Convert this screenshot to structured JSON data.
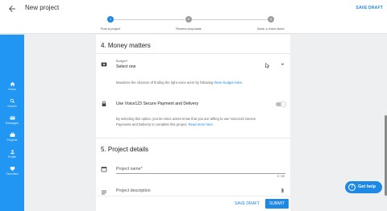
{
  "header": {
    "title": "New project",
    "save_draft": "SAVE DRAFT",
    "steps": [
      {
        "number": "1",
        "label": "Post a project",
        "active": true
      },
      {
        "number": "2",
        "label": "Review proposals",
        "active": false
      },
      {
        "number": "3",
        "label": "Book a Voice Actor",
        "active": false
      }
    ]
  },
  "sidebar": {
    "items": [
      {
        "label": "Home",
        "icon": "home-icon"
      },
      {
        "label": "Search",
        "icon": "search-icon"
      },
      {
        "label": "Messages",
        "icon": "mail-icon"
      },
      {
        "label": "Projects",
        "icon": "briefcase-icon"
      },
      {
        "label": "Profile",
        "icon": "person-icon"
      },
      {
        "label": "Favorites",
        "icon": "heart-icon"
      }
    ]
  },
  "money": {
    "title": "4. Money matters",
    "budget_label": "Budget*",
    "budget_value": "Select one",
    "budget_help_prefix": "Maximize the chances of finding the right voice actor by following ",
    "budget_help_link": "these budget rules",
    "budget_help_suffix": ".",
    "secure_label": "Use Voice123 Secure Payment and Delivery",
    "secure_help_line1": "By selecting this option, you let voice actors know that you are willing to use Voice123 Secure",
    "secure_help_line2_prefix": "Payments and Delivery to complete this project. ",
    "secure_help_link": "Read more here."
  },
  "details": {
    "title": "5. Project details",
    "name_placeholder": "Project name*",
    "name_counter": "0 / 50",
    "description_placeholder": "Project description"
  },
  "footer": {
    "save_draft": "SAVE DRAFT",
    "submit": "SUBMIT"
  },
  "help": {
    "label": "Get help"
  },
  "colors": {
    "accent": "#1e88e5",
    "sidebar": "#2196f3"
  }
}
